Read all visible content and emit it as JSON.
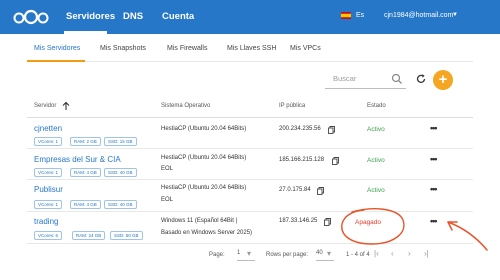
{
  "topbar": {
    "brand_color": "#2777c9",
    "nav": [
      "Servidores",
      "DNS",
      "Cuenta"
    ],
    "active_nav": "Servidores",
    "language": "Es",
    "user_email": "cjn1984@hotmail.com"
  },
  "tabs": [
    "Mis Servidores",
    "Mis Snapshots",
    "Mis Firewalls",
    "Mis Llaves SSH",
    "Mis VPCs"
  ],
  "active_tab": "Mis Servidores",
  "search": {
    "placeholder": "Buscar"
  },
  "table": {
    "columns": [
      "Servidor",
      "Sistema Operativo",
      "IP pública",
      "Estado"
    ],
    "rows": [
      {
        "name": "cjnetten",
        "vcores": "VCores: 1",
        "ram": "RAM: 2 GB",
        "ssd": "SSD: 15 GB",
        "os1": "HestiaCP (Ubuntu 20.04 64Bits)",
        "os2": "",
        "ip": "200.234.235.56",
        "state": "Activo"
      },
      {
        "name": "Empresas del Sur & CIA",
        "vcores": "VCores: 1",
        "ram": "RAM: 4 GB",
        "ssd": "SSD: 40 GB",
        "os1": "HestiaCP (Ubuntu 20.04 64Bits)",
        "os2": "EOL",
        "ip": "185.166.215.128",
        "state": "Activo"
      },
      {
        "name": "Publisur",
        "vcores": "VCores: 1",
        "ram": "RAM: 4 GB",
        "ssd": "SSD: 40 GB",
        "os1": "HestiaCP (Ubuntu 20.04 64Bits)",
        "os2": "EOL",
        "ip": "27.0.175.84",
        "state": "Activo"
      },
      {
        "name": "trading",
        "vcores": "VCores: 6",
        "ram": "RAM: 24 GB",
        "ssd": "SSD: 50 GB",
        "os1": "Windows 11 (Español 64Bit |",
        "os2": "Basado en Windows Server 2025)",
        "ip": "187.33.146.25",
        "state": "Apagado"
      }
    ]
  },
  "pager": {
    "page_label": "Page:",
    "page_value": "1",
    "rows_label": "Rows per page:",
    "rows_value": "40",
    "range": "1 - 4 of 4"
  },
  "colors": {
    "active": "#3aa34a",
    "off": "#e53b2c",
    "accent": "#f5a623",
    "annotation": "#e8542a"
  }
}
